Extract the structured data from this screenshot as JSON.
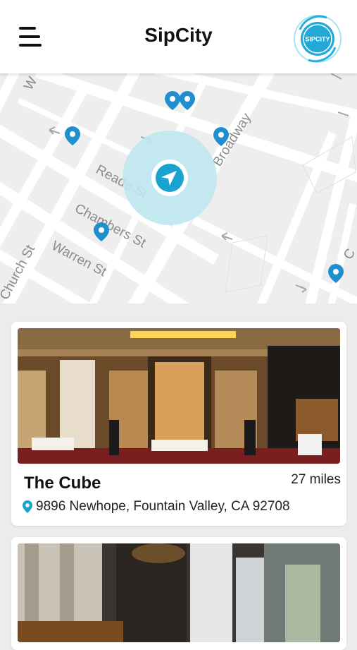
{
  "header": {
    "title": "SipCity",
    "menu_icon": "hamburger-menu-icon",
    "logo_text": "SIPCITY"
  },
  "map": {
    "streets": {
      "reade": "Reade St",
      "chambers": "Chambers St",
      "warren": "Warren St",
      "church": "Church St",
      "broadway": "Broadway",
      "w_partial": "W",
      "c_partial": "C"
    },
    "user_location_icon": "navigation-arrow-icon",
    "marker_icon": "map-pin-icon",
    "colors": {
      "marker": "#1f8fce",
      "location_halo": "#bfe7ef",
      "location_dot": "#1aa3d0"
    }
  },
  "venues": [
    {
      "name": "The Cube",
      "distance": "27 miles",
      "address": "9896 Newhope, Fountain Valley, CA 92708",
      "address_icon": "location-pin-icon"
    },
    {
      "name": "",
      "distance": "",
      "address": ""
    }
  ]
}
